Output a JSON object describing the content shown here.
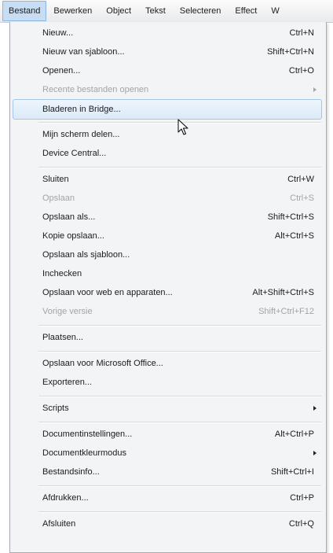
{
  "menubar": {
    "items": [
      "Bestand",
      "Bewerken",
      "Object",
      "Tekst",
      "Selecteren",
      "Effect",
      "W"
    ]
  },
  "menu": {
    "items": [
      {
        "label": "Nieuw...",
        "shortcut": "Ctrl+N",
        "disabled": false
      },
      {
        "label": "Nieuw van sjabloon...",
        "shortcut": "Shift+Ctrl+N",
        "disabled": false
      },
      {
        "label": "Openen...",
        "shortcut": "Ctrl+O",
        "disabled": false
      },
      {
        "label": "Recente bestanden openen",
        "shortcut": "",
        "disabled": true,
        "submenu": true
      },
      {
        "label": "Bladeren in Bridge...",
        "shortcut": "",
        "disabled": false,
        "highlighted": true
      },
      {
        "label": "Mijn scherm delen...",
        "shortcut": "",
        "disabled": false
      },
      {
        "label": "Device Central...",
        "shortcut": "",
        "disabled": false
      },
      {
        "label": "Sluiten",
        "shortcut": "Ctrl+W",
        "disabled": false
      },
      {
        "label": "Opslaan",
        "shortcut": "Ctrl+S",
        "disabled": true
      },
      {
        "label": "Opslaan als...",
        "shortcut": "Shift+Ctrl+S",
        "disabled": false
      },
      {
        "label": "Kopie opslaan...",
        "shortcut": "Alt+Ctrl+S",
        "disabled": false
      },
      {
        "label": "Opslaan als sjabloon...",
        "shortcut": "",
        "disabled": false
      },
      {
        "label": "Inchecken",
        "shortcut": "",
        "disabled": false
      },
      {
        "label": "Opslaan voor web en apparaten...",
        "shortcut": "Alt+Shift+Ctrl+S",
        "disabled": false
      },
      {
        "label": "Vorige versie",
        "shortcut": "Shift+Ctrl+F12",
        "disabled": true
      },
      {
        "label": "Plaatsen...",
        "shortcut": "",
        "disabled": false
      },
      {
        "label": "Opslaan voor Microsoft Office...",
        "shortcut": "",
        "disabled": false
      },
      {
        "label": "Exporteren...",
        "shortcut": "",
        "disabled": false
      },
      {
        "label": "Scripts",
        "shortcut": "",
        "disabled": false,
        "submenu": true
      },
      {
        "label": "Documentinstellingen...",
        "shortcut": "Alt+Ctrl+P",
        "disabled": false
      },
      {
        "label": "Documentkleurmodus",
        "shortcut": "",
        "disabled": false,
        "submenu": true
      },
      {
        "label": "Bestandsinfo...",
        "shortcut": "Shift+Ctrl+I",
        "disabled": false
      },
      {
        "label": "Afdrukken...",
        "shortcut": "Ctrl+P",
        "disabled": false
      },
      {
        "label": "Afsluiten",
        "shortcut": "Ctrl+Q",
        "disabled": false
      }
    ]
  },
  "colors": {
    "highlight": "#dbeaf8",
    "highlight_border": "#a6c6e7",
    "disabled_text": "#a2a4a8"
  }
}
